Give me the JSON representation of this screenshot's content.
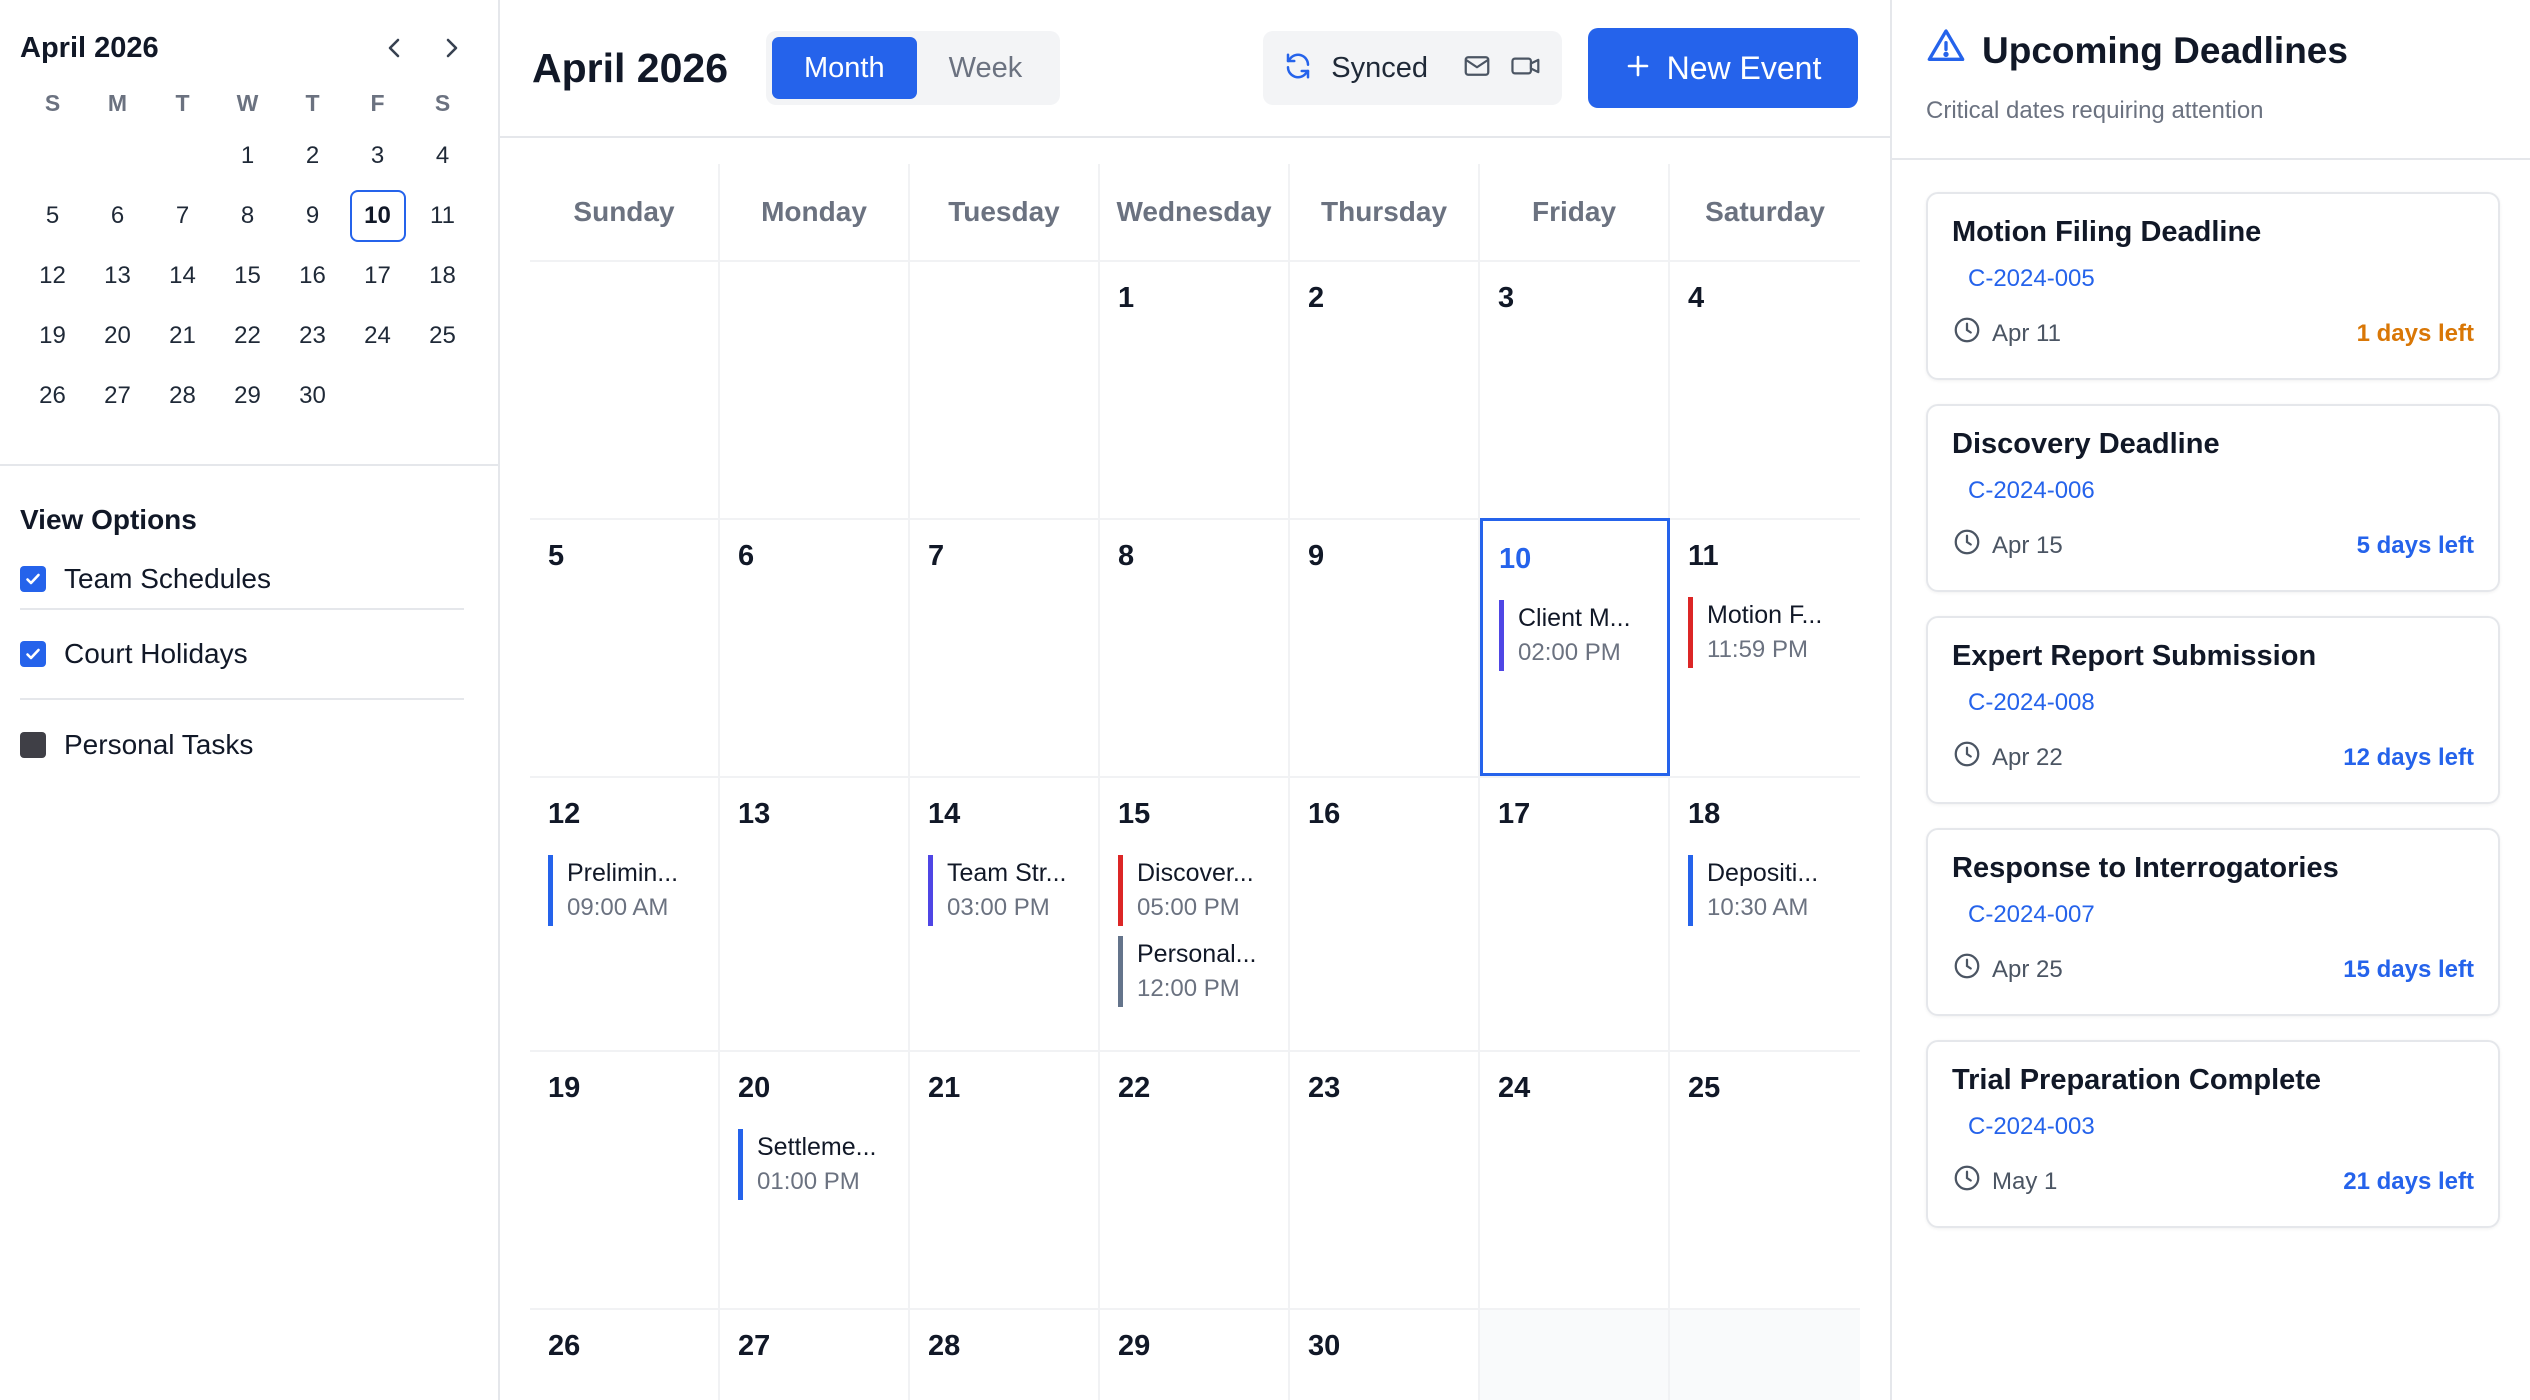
{
  "mini_calendar": {
    "title": "April 2026",
    "dow": [
      "S",
      "M",
      "T",
      "W",
      "T",
      "F",
      "S"
    ],
    "weeks": [
      [
        "",
        "",
        "",
        "1",
        "2",
        "3",
        "4"
      ],
      [
        "5",
        "6",
        "7",
        "8",
        "9",
        "10",
        "11"
      ],
      [
        "12",
        "13",
        "14",
        "15",
        "16",
        "17",
        "18"
      ],
      [
        "19",
        "20",
        "21",
        "22",
        "23",
        "24",
        "25"
      ],
      [
        "26",
        "27",
        "28",
        "29",
        "30",
        "",
        ""
      ]
    ],
    "today": "10"
  },
  "view_options": {
    "title": "View Options",
    "items": [
      {
        "label": "Team Schedules",
        "checked": true
      },
      {
        "label": "Court Holidays",
        "checked": true
      },
      {
        "label": "Personal Tasks",
        "checked": false
      }
    ]
  },
  "toolbar": {
    "title": "April 2026",
    "views": [
      "Month",
      "Week"
    ],
    "active_view": "Month",
    "sync_label": "Synced",
    "new_event_label": "New Event"
  },
  "calendar": {
    "dow": [
      "Sunday",
      "Monday",
      "Tuesday",
      "Wednesday",
      "Thursday",
      "Friday",
      "Saturday"
    ],
    "today": "10",
    "cells": [
      {
        "day": ""
      },
      {
        "day": ""
      },
      {
        "day": ""
      },
      {
        "day": "1"
      },
      {
        "day": "2"
      },
      {
        "day": "3"
      },
      {
        "day": "4"
      },
      {
        "day": "5"
      },
      {
        "day": "6"
      },
      {
        "day": "7"
      },
      {
        "day": "8"
      },
      {
        "day": "9"
      },
      {
        "day": "10",
        "events": [
          {
            "title": "Client M...",
            "time": "02:00 PM",
            "color": "#4f46e5"
          }
        ]
      },
      {
        "day": "11",
        "events": [
          {
            "title": "Motion F...",
            "time": "11:59 PM",
            "color": "#dc2626"
          }
        ]
      },
      {
        "day": "12",
        "events": [
          {
            "title": "Prelimin...",
            "time": "09:00 AM",
            "color": "#2563eb"
          }
        ]
      },
      {
        "day": "13"
      },
      {
        "day": "14",
        "events": [
          {
            "title": "Team Str...",
            "time": "03:00 PM",
            "color": "#4f46e5"
          }
        ]
      },
      {
        "day": "15",
        "events": [
          {
            "title": "Discover...",
            "time": "05:00 PM",
            "color": "#dc2626"
          },
          {
            "title": "Personal...",
            "time": "12:00 PM",
            "color": "#64748b"
          }
        ]
      },
      {
        "day": "16"
      },
      {
        "day": "17"
      },
      {
        "day": "18",
        "events": [
          {
            "title": "Depositi...",
            "time": "10:30 AM",
            "color": "#2563eb"
          }
        ]
      },
      {
        "day": "19"
      },
      {
        "day": "20",
        "events": [
          {
            "title": "Settleme...",
            "time": "01:00 PM",
            "color": "#2563eb"
          }
        ]
      },
      {
        "day": "21"
      },
      {
        "day": "22"
      },
      {
        "day": "23"
      },
      {
        "day": "24"
      },
      {
        "day": "25"
      },
      {
        "day": "26"
      },
      {
        "day": "27"
      },
      {
        "day": "28"
      },
      {
        "day": "29"
      },
      {
        "day": "30"
      },
      {
        "day": "",
        "gray": true
      },
      {
        "day": "",
        "gray": true
      }
    ]
  },
  "deadlines": {
    "title": "Upcoming Deadlines",
    "subtitle": "Critical dates requiring attention",
    "items": [
      {
        "title": "Motion Filing Deadline",
        "case": "C-2024-005",
        "date": "Apr 11",
        "left": "1 days left",
        "color": "#d97706"
      },
      {
        "title": "Discovery Deadline",
        "case": "C-2024-006",
        "date": "Apr 15",
        "left": "5 days left",
        "color": "#2563eb"
      },
      {
        "title": "Expert Report Submission",
        "case": "C-2024-008",
        "date": "Apr 22",
        "left": "12 days left",
        "color": "#2563eb"
      },
      {
        "title": "Response to Interrogatories",
        "case": "C-2024-007",
        "date": "Apr 25",
        "left": "15 days left",
        "color": "#2563eb"
      },
      {
        "title": "Trial Preparation Complete",
        "case": "C-2024-003",
        "date": "May 1",
        "left": "21 days left",
        "color": "#2563eb"
      }
    ]
  },
  "colors": {
    "accent": "#2563eb",
    "urgent": "#d97706"
  }
}
